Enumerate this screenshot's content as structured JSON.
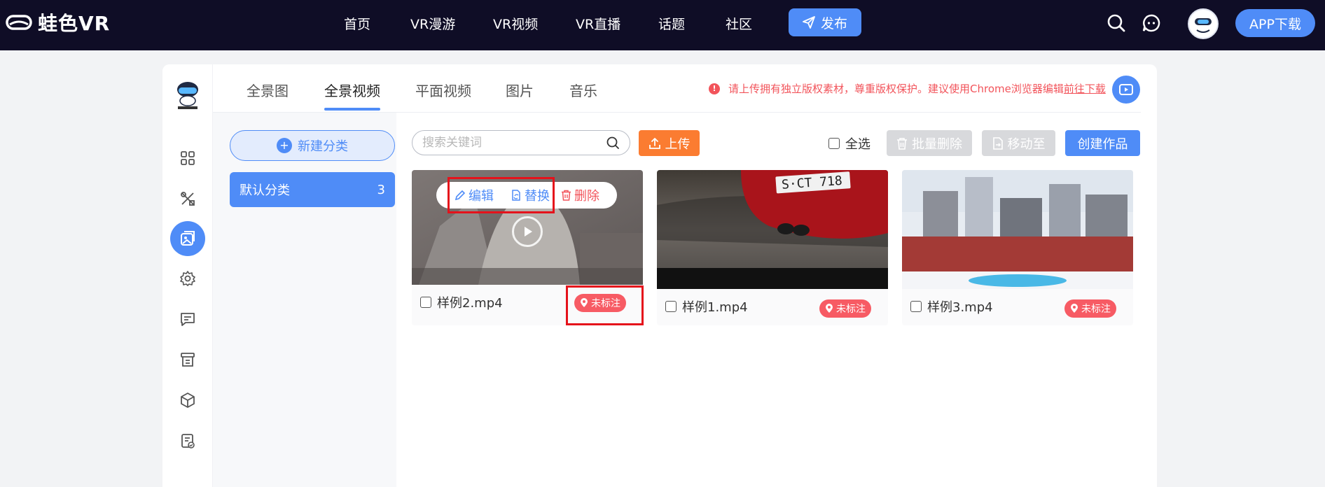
{
  "brand": {
    "name": "蛙色VR"
  },
  "nav": {
    "items": [
      {
        "label": "首页"
      },
      {
        "label": "VR漫游"
      },
      {
        "label": "VR视频"
      },
      {
        "label": "VR直播"
      },
      {
        "label": "话题"
      },
      {
        "label": "社区"
      }
    ],
    "publish_label": "发布",
    "app_download_label": "APP下载"
  },
  "tabs": [
    {
      "label": "全景图"
    },
    {
      "label": "全景视频",
      "active": true
    },
    {
      "label": "平面视频"
    },
    {
      "label": "图片"
    },
    {
      "label": "音乐"
    }
  ],
  "notice": {
    "text": "请上传拥有独立版权素材，尊重版权保护。建议使用Chrome浏览器编辑",
    "link": "前往下载"
  },
  "categories": {
    "new_label": "新建分类",
    "items": [
      {
        "label": "默认分类",
        "count": "3"
      }
    ]
  },
  "toolbar": {
    "search_placeholder": "搜索关键词",
    "upload_label": "上传",
    "select_all_label": "全选",
    "batch_delete_label": "批量删除",
    "move_to_label": "移动至",
    "create_label": "创建作品"
  },
  "cards": [
    {
      "name": "样例2.mp4",
      "tag": "未标注"
    },
    {
      "name": "样例1.mp4",
      "tag": "未标注"
    },
    {
      "name": "样例3.mp4",
      "tag": "未标注"
    }
  ],
  "card_menu": {
    "edit": "编辑",
    "replace": "替换",
    "delete": "删除"
  },
  "colors": {
    "accent": "#4f8cf7",
    "topbar": "#0f0d26",
    "orange": "#fb7c31",
    "danger": "#f75b64",
    "highlight": "#e5121b"
  }
}
